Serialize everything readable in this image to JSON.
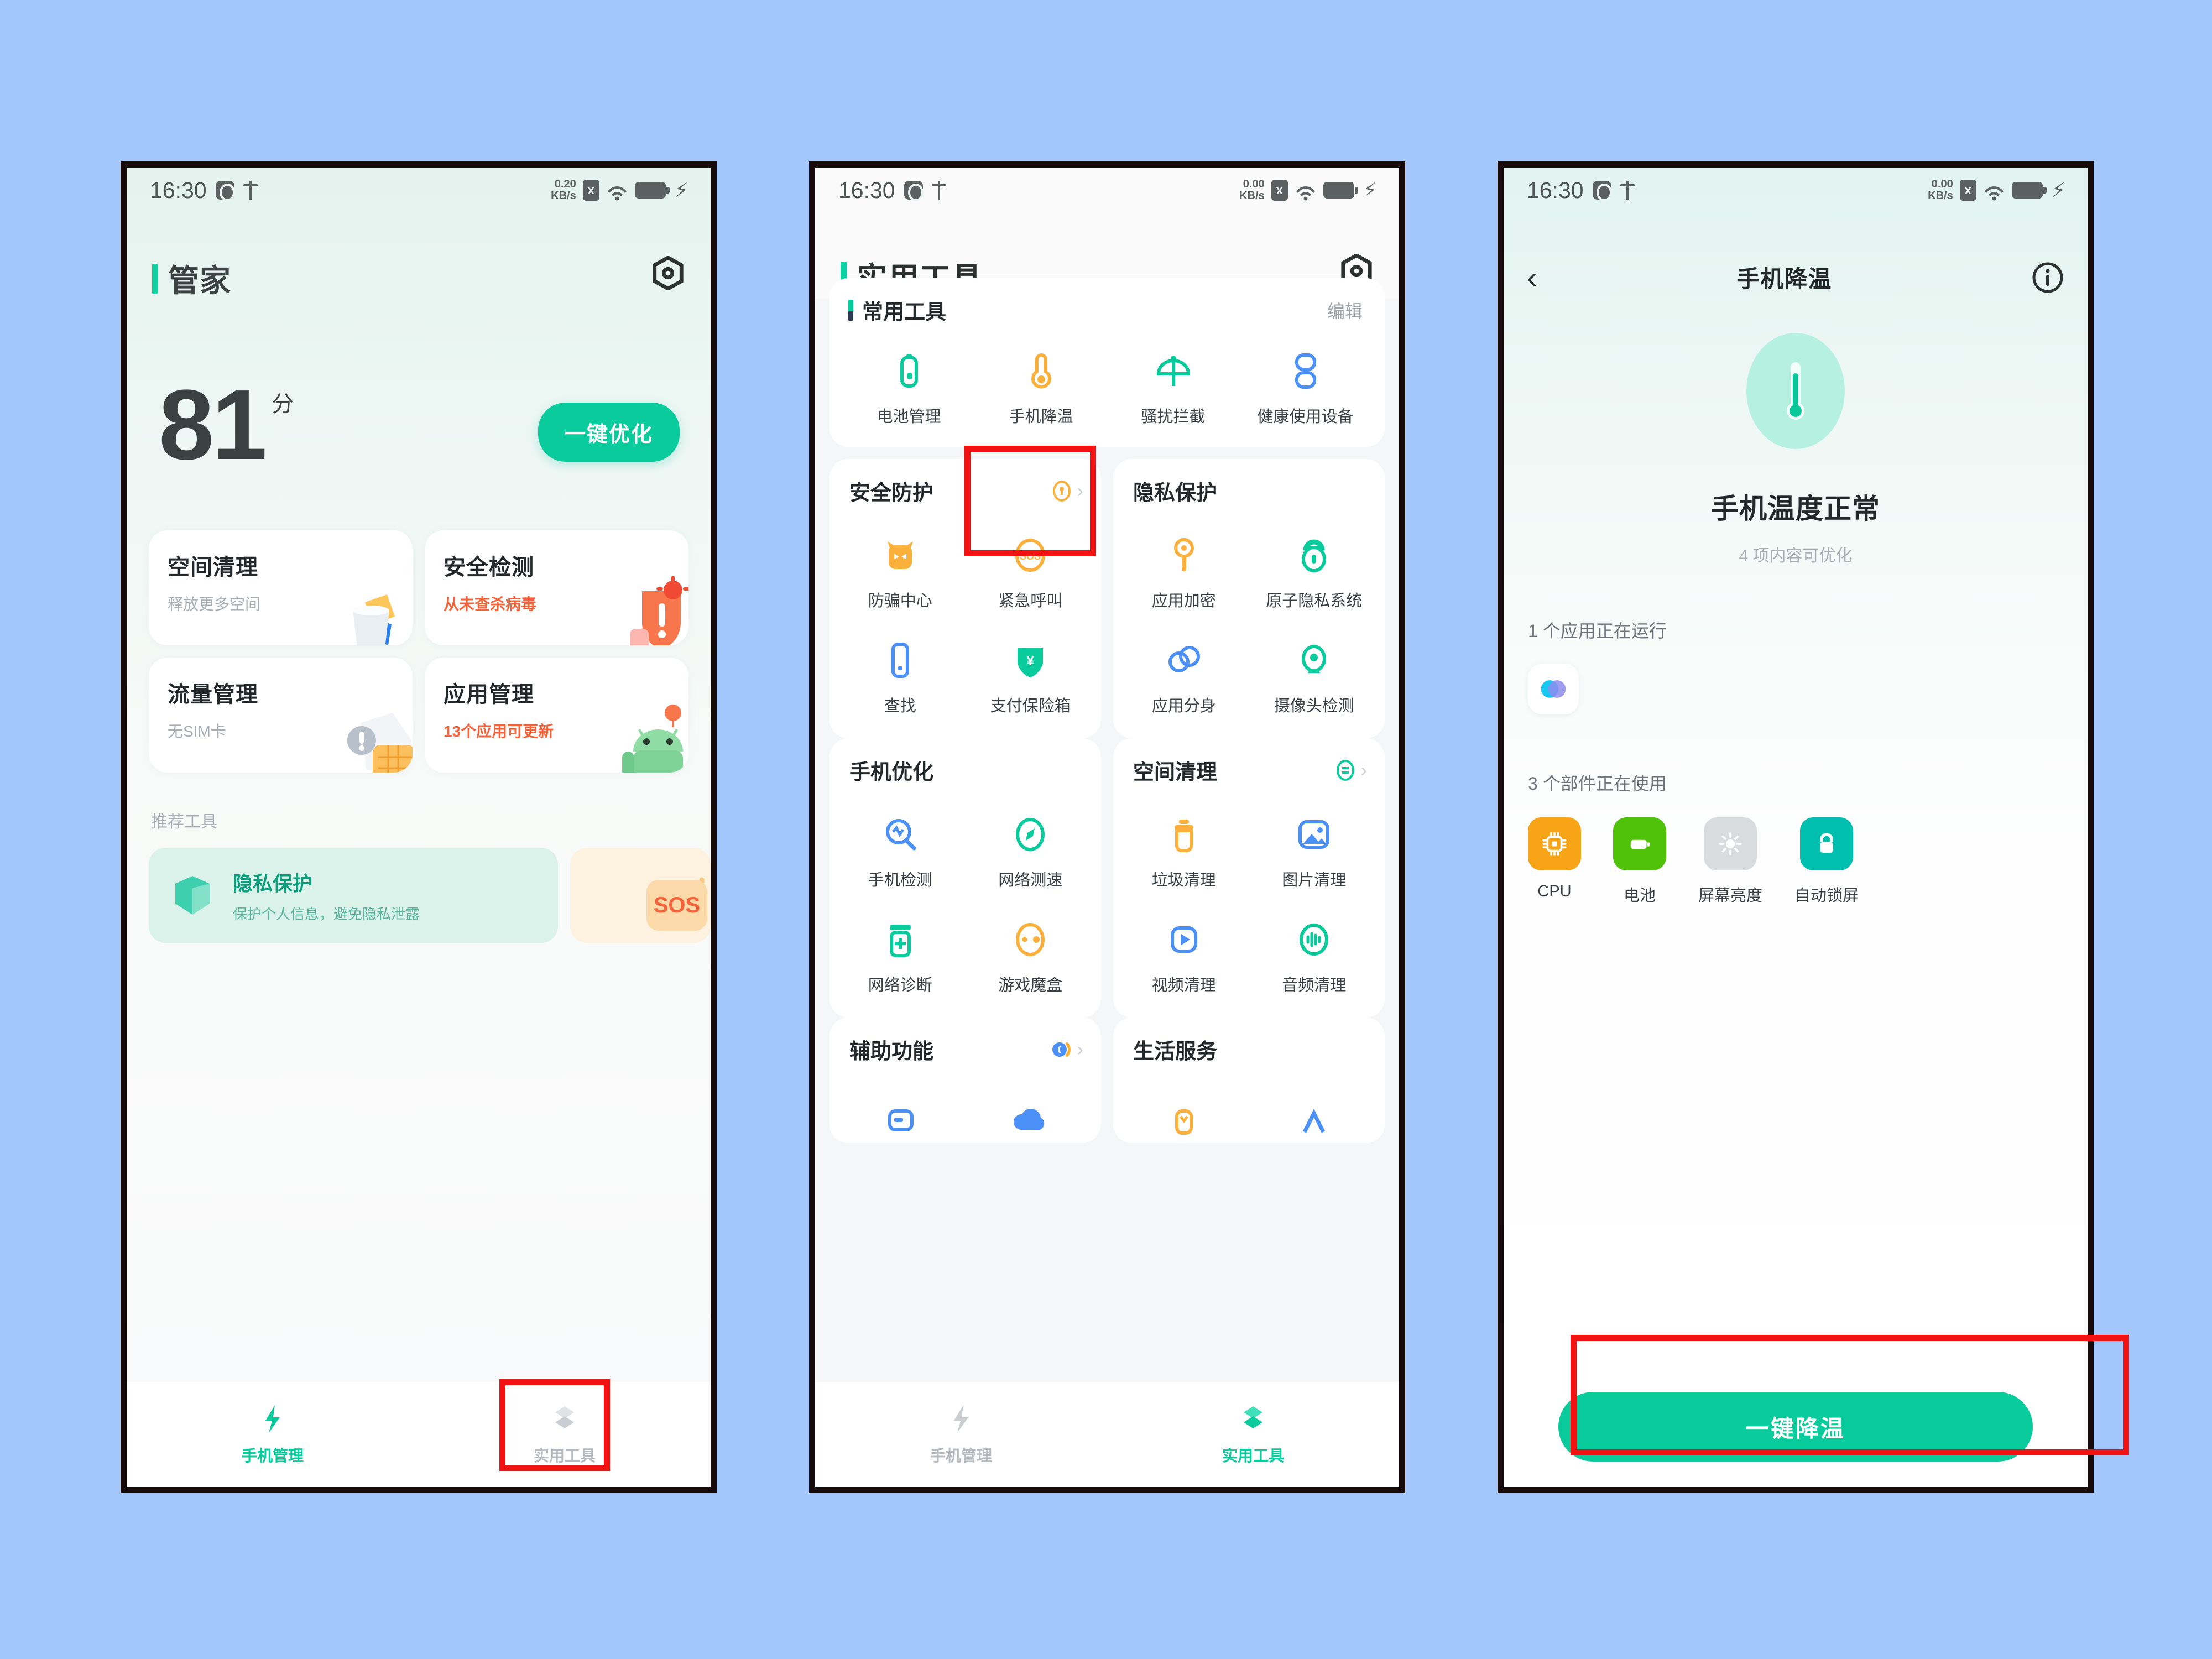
{
  "background_color": "#a3c6fb",
  "accent_color": "#09cb9b",
  "highlight_color": "#f31212",
  "status_bar": {
    "time": "16:30",
    "speed_1": "0.20",
    "speed_2": "0.00",
    "speed_unit": "KB/s",
    "sim_glyph": "x",
    "bolt": "⚡"
  },
  "phone1": {
    "app_title": "i管家",
    "app_title_prefix": "i",
    "app_title_main": "管家",
    "gear_icon": "gear-icon",
    "score": "81",
    "score_unit": "分",
    "optimize_button": "一键优化",
    "cards": [
      {
        "title": "空间清理",
        "subtitle": "释放更多空间",
        "warn": false
      },
      {
        "title": "安全检测",
        "subtitle": "从未查杀病毒",
        "warn": true
      },
      {
        "title": "流量管理",
        "subtitle": "无SIM卡",
        "warn": false
      },
      {
        "title": "应用管理",
        "subtitle": "13个应用可更新",
        "warn": true
      }
    ],
    "recommend_label": "推荐工具",
    "recommend": {
      "title": "隐私保护",
      "subtitle": "保护个人信息，避免隐私泄露",
      "side_badge": "SOS"
    },
    "nav": [
      {
        "label": "手机管理",
        "active": true,
        "icon": "bolt-icon"
      },
      {
        "label": "实用工具",
        "active": false,
        "icon": "layers-icon"
      }
    ]
  },
  "phone2": {
    "page_title": "实用工具",
    "gear_icon": "gear-icon",
    "common_tools": {
      "title": "常用工具",
      "edit": "编辑",
      "items": [
        {
          "label": "电池管理",
          "icon": "battery-icon",
          "color": "#09cb9b"
        },
        {
          "label": "手机降温",
          "icon": "thermometer-icon",
          "color": "#fbb03b"
        },
        {
          "label": "骚扰拦截",
          "icon": "umbrella-icon",
          "color": "#09cb9b"
        },
        {
          "label": "健康使用设备",
          "icon": "hourglass-icon",
          "color": "#4a90f7"
        }
      ]
    },
    "sections": [
      {
        "title": "安全防护",
        "head_icon": "shield-key-icon",
        "head_icon_color": "#fbb03b",
        "has_chevron": true,
        "items": [
          {
            "label": "防骗中心",
            "icon": "fraud-icon",
            "color": "#fbb03b"
          },
          {
            "label": "紧急呼叫",
            "icon": "sos-icon",
            "color": "#fbb03b"
          },
          {
            "label": "查找",
            "icon": "phone-find-icon",
            "color": "#4a90f7"
          },
          {
            "label": "支付保险箱",
            "icon": "pay-shield-icon",
            "color": "#09cb9b"
          }
        ]
      },
      {
        "title": "隐私保护",
        "head_icon": "",
        "head_icon_color": "",
        "has_chevron": false,
        "items": [
          {
            "label": "应用加密",
            "icon": "key-icon",
            "color": "#fbb03b"
          },
          {
            "label": "原子隐私系统",
            "icon": "lock-atom-icon",
            "color": "#09cb9b"
          },
          {
            "label": "应用分身",
            "icon": "clone-icon",
            "color": "#4a90f7"
          },
          {
            "label": "摄像头检测",
            "icon": "camera-detect-icon",
            "color": "#09cb9b"
          }
        ]
      },
      {
        "title": "手机优化",
        "head_icon": "",
        "head_icon_color": "",
        "has_chevron": false,
        "items": [
          {
            "label": "手机检测",
            "icon": "diagnose-icon",
            "color": "#4a90f7"
          },
          {
            "label": "网络测速",
            "icon": "compass-icon",
            "color": "#09cb9b"
          },
          {
            "label": "网络诊断",
            "icon": "network-fix-icon",
            "color": "#09cb9b"
          },
          {
            "label": "游戏魔盒",
            "icon": "gamepad-icon",
            "color": "#fbb03b"
          }
        ]
      },
      {
        "title": "空间清理",
        "head_icon": "storage-icon",
        "head_icon_color": "#09cb9b",
        "has_chevron": true,
        "items": [
          {
            "label": "垃圾清理",
            "icon": "trash-icon",
            "color": "#fbb03b"
          },
          {
            "label": "图片清理",
            "icon": "image-icon",
            "color": "#4a90f7"
          },
          {
            "label": "视频清理",
            "icon": "video-icon",
            "color": "#4a90f7"
          },
          {
            "label": "音频清理",
            "icon": "audio-icon",
            "color": "#09cb9b"
          }
        ]
      },
      {
        "title": "辅助功能",
        "head_icon": "call-assist-icon",
        "head_icon_color": "#4a90f7",
        "has_chevron": true,
        "items": []
      },
      {
        "title": "生活服务",
        "head_icon": "",
        "head_icon_color": "",
        "has_chevron": false,
        "items": []
      }
    ],
    "nav": [
      {
        "label": "手机管理",
        "active": false,
        "icon": "bolt-icon"
      },
      {
        "label": "实用工具",
        "active": true,
        "icon": "layers-icon"
      }
    ]
  },
  "phone3": {
    "back_icon": "chevron-left-icon",
    "page_title": "手机降温",
    "info_icon": "info-icon",
    "thermometer_icon": "thermometer-icon",
    "status_title": "手机温度正常",
    "status_sub": "4 项内容可优化",
    "running_apps_label": "1 个应用正在运行",
    "running_apps": [
      {
        "icon": "venn-app-icon"
      }
    ],
    "components_label": "3 个部件正在使用",
    "components": [
      {
        "label": "CPU",
        "icon": "cpu-icon",
        "color": "#f7a417"
      },
      {
        "label": "电池",
        "icon": "battery-icon",
        "color": "#4fc109"
      },
      {
        "label": "屏幕亮度",
        "icon": "brightness-icon",
        "color": "#d9dcdf"
      },
      {
        "label": "自动锁屏",
        "icon": "lock-icon",
        "color": "#00bfae"
      }
    ],
    "action_button": "一键降温"
  }
}
